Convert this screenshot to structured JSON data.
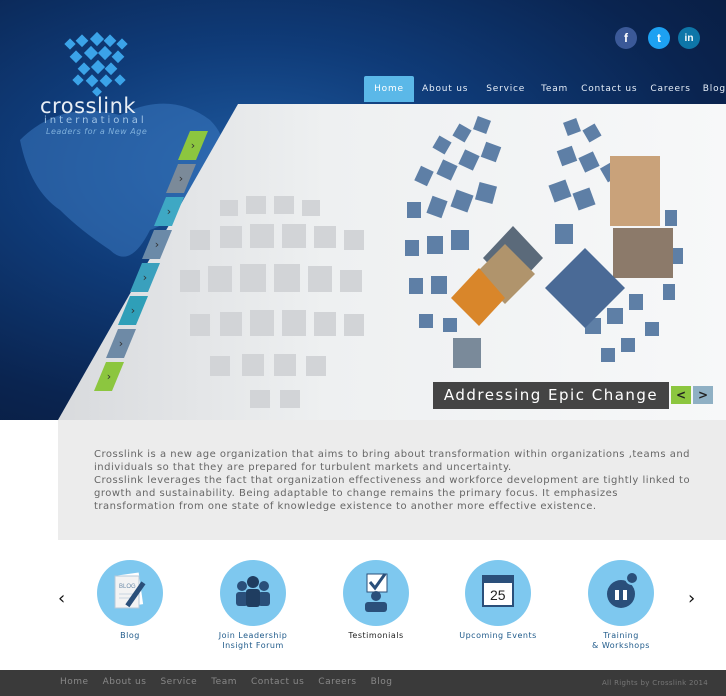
{
  "brand": {
    "name": "crosslink",
    "sub": "international",
    "tagline": "Leaders for a New Age"
  },
  "social": [
    {
      "icon": "facebook-icon",
      "glyph": "f",
      "color": "#3b5998"
    },
    {
      "icon": "twitter-icon",
      "glyph": "t",
      "color": "#1da1f2"
    },
    {
      "icon": "linkedin-icon",
      "glyph": "in",
      "color": "#0e76a8"
    }
  ],
  "nav": [
    "Home",
    "About us",
    "Service",
    "Team",
    "Contact us",
    "Careers",
    "Blog"
  ],
  "slider": {
    "caption": "Addressing Epic Change",
    "prev": "<",
    "next": ">"
  },
  "intro": [
    "Crosslink is a new age organization that aims to bring about transformation within organizations ,teams and individuals so that they are prepared for turbulent markets and uncertainty.",
    "Crosslink leverages the fact that organization effectiveness and workforce development are tightly linked to growth and sustainability. Being adaptable to change remains the primary focus. It emphasizes transformation from one state of knowledge existence to another more effective existence."
  ],
  "features": [
    {
      "label": "Blog",
      "icon": "blog-icon"
    },
    {
      "label": "Join Leadership\nInsight Forum",
      "icon": "forum-icon"
    },
    {
      "label": "Testimonials",
      "icon": "testimonials-icon"
    },
    {
      "label": "Upcoming Events",
      "icon": "calendar-icon"
    },
    {
      "label": "Training\n& Workshops",
      "icon": "training-icon"
    }
  ],
  "calendar_day": "25",
  "carousel": {
    "prev": "‹",
    "next": "›"
  },
  "footer": {
    "nav": [
      "Home",
      "About us",
      "Service",
      "Team",
      "Contact us",
      "Careers",
      "Blog"
    ],
    "copyright": "All Rights by Crosslink 2014"
  },
  "colors": {
    "accent": "#5bb8e8",
    "green_tab": "#8cc63f",
    "teal_tab": "#3ea8c4",
    "gray_tab": "#7b8a99"
  }
}
